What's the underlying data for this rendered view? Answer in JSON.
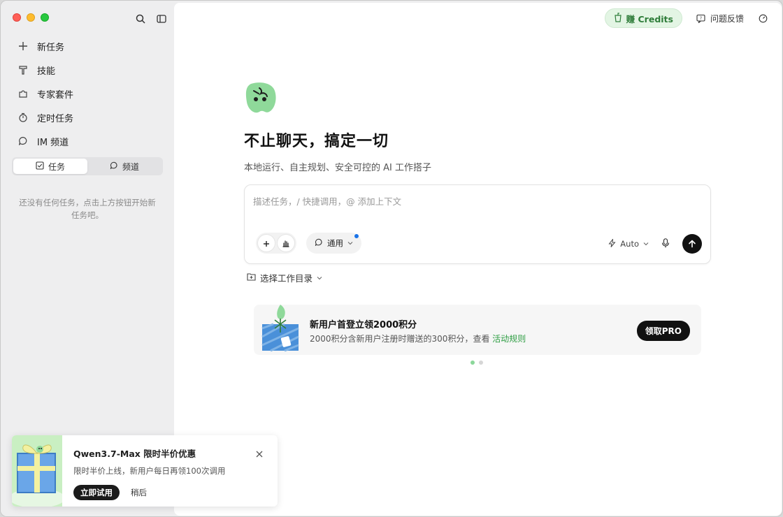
{
  "sidebar": {
    "items": [
      {
        "label": "新任务",
        "icon": "plus-icon"
      },
      {
        "label": "技能",
        "icon": "skill-icon"
      },
      {
        "label": "专家套件",
        "icon": "puzzle-icon"
      },
      {
        "label": "定时任务",
        "icon": "timer-icon"
      },
      {
        "label": "IM 频道",
        "icon": "chat-icon"
      }
    ],
    "segments": [
      {
        "label": "任务",
        "icon": "checkbox-icon",
        "active": true
      },
      {
        "label": "频道",
        "icon": "chat-icon",
        "active": false
      }
    ],
    "empty_hint": "还没有任何任务，点击上方按钮开始新任务吧。"
  },
  "topbar": {
    "credits_label": "赚 Credits",
    "feedback_label": "问题反馈"
  },
  "hero": {
    "title": "不止聊天，搞定一切",
    "subtitle": "本地运行、自主规划、安全可控的 AI 工作搭子"
  },
  "composer": {
    "placeholder": "描述任务，/ 快捷调用，@ 添加上下文",
    "mode_label": "通用",
    "model_label": "Auto"
  },
  "workdir": {
    "label": "选择工作目录"
  },
  "banner": {
    "title": "新用户首登立领2000积分",
    "desc": "2000积分含新用户注册时赠送的300积分，查看",
    "link": "活动规则",
    "button": "领取PRO"
  },
  "toast": {
    "title": "Qwen3.7-Max 限时半价优惠",
    "desc": "限时半价上线，新用户每日再领100次调用",
    "primary": "立即试用",
    "secondary": "稍后"
  },
  "colors": {
    "accent_green": "#2f9e44",
    "credits_bg": "#e3f5e4",
    "dark": "#111111",
    "mode_dot": "#1a73e8"
  }
}
